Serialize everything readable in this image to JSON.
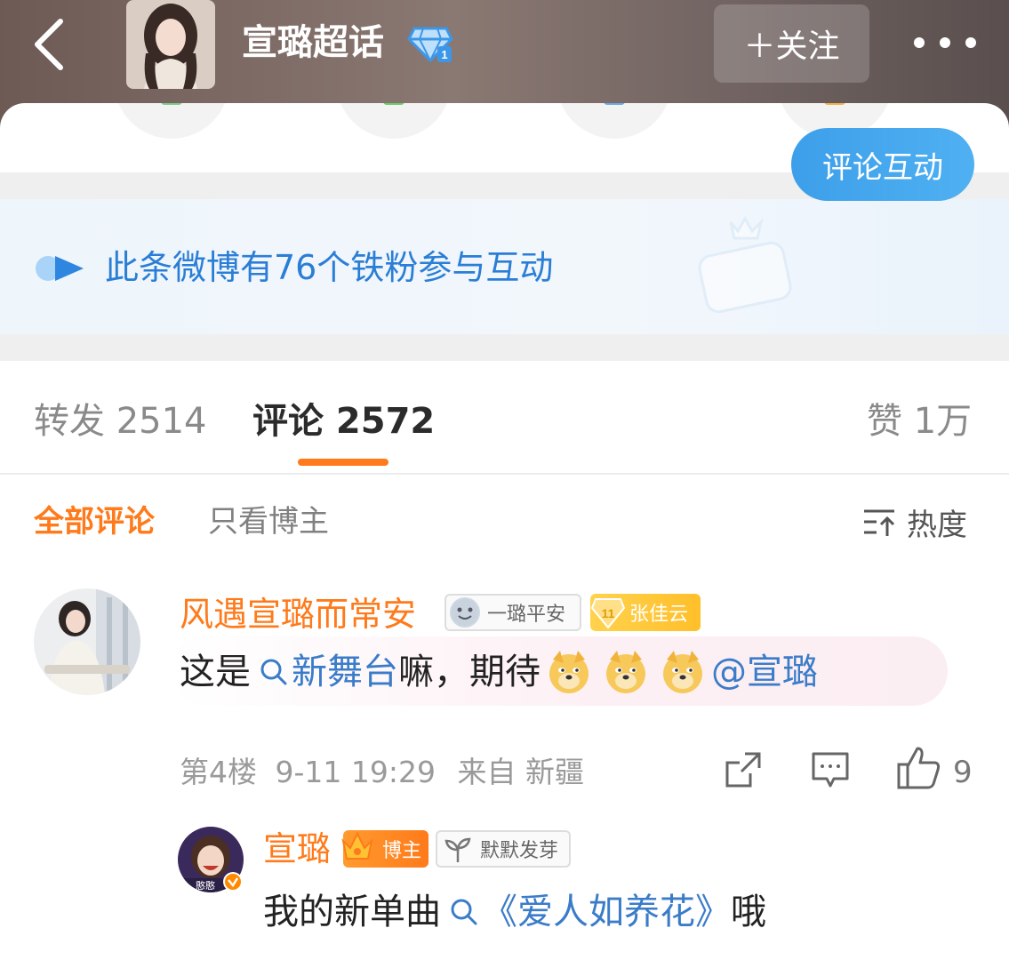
{
  "header": {
    "title": "宣璐超话",
    "follow_label": "＋关注"
  },
  "banner": {
    "text": "此条微博有76个铁粉参与互动",
    "button_label": "评论互动"
  },
  "tabs": [
    {
      "label": "转发 2514",
      "active": false
    },
    {
      "label": "评论 2572",
      "active": true
    },
    {
      "label": "赞 1万",
      "active": false
    }
  ],
  "filters": {
    "all": "全部评论",
    "author_only": "只看博主",
    "sort": "热度"
  },
  "comment": {
    "user": "风遇宣璐而常安",
    "badge_group": "一璐平安",
    "badge_level": "11",
    "badge_fan": "张佳云",
    "text_before": "这是",
    "topic": "新舞台",
    "text_after": "嘛，期待",
    "mention": "@宣璐",
    "floor": "第4楼",
    "time": "9-11 19:29",
    "location": "来自 新疆",
    "likes": "9"
  },
  "reply": {
    "user": "宣璐",
    "badge_author": "博主",
    "badge_group": "默默发芽",
    "text_before": "我的新单曲",
    "topic": "《爱人如养花》",
    "text_after": "哦",
    "avatar_caption": "憨憨"
  },
  "colors": {
    "accent": "#ff7a1a",
    "link": "#3b7cc9",
    "banner_text": "#2a7ed6"
  }
}
